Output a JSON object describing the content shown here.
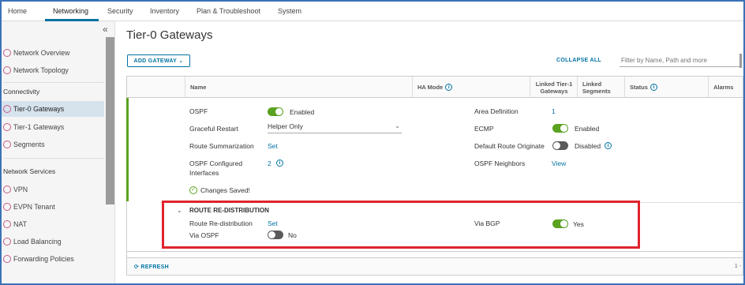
{
  "nav": {
    "tabs": [
      "Home",
      "Networking",
      "Security",
      "Inventory",
      "Plan & Troubleshoot",
      "System"
    ],
    "active": "Networking"
  },
  "sidebar": {
    "top_items": [
      {
        "label": "Network Overview",
        "icon": "network-overview-icon"
      },
      {
        "label": "Network Topology",
        "icon": "network-topology-icon"
      }
    ],
    "connectivity_header": "Connectivity",
    "connectivity_items": [
      {
        "label": "Tier-0 Gateways",
        "icon": "tier0-gateway-icon",
        "active": true
      },
      {
        "label": "Tier-1 Gateways",
        "icon": "tier1-gateway-icon"
      },
      {
        "label": "Segments",
        "icon": "segments-icon"
      }
    ],
    "services_header": "Network Services",
    "services_items": [
      {
        "label": "VPN",
        "icon": "vpn-icon"
      },
      {
        "label": "EVPN Tenant",
        "icon": "evpn-tenant-icon"
      },
      {
        "label": "NAT",
        "icon": "nat-icon"
      },
      {
        "label": "Load Balancing",
        "icon": "load-balancing-icon"
      },
      {
        "label": "Forwarding Policies",
        "icon": "forwarding-policies-icon"
      }
    ]
  },
  "page": {
    "title": "Tier-0 Gateways",
    "add_gateway": "ADD GATEWAY",
    "collapse_all": "COLLAPSE ALL",
    "filter_placeholder": "Filter by Name, Path and more"
  },
  "grid": {
    "columns": [
      "Name",
      "HA Mode",
      "Linked Tier-1 Gateways",
      "Linked Segments",
      "Status",
      "Alarms"
    ],
    "refresh": "REFRESH",
    "pager": "1 -"
  },
  "ospf": {
    "ospf_label": "OSPF",
    "ospf_value": "Enabled",
    "graceful_label": "Graceful Restart",
    "graceful_value": "Helper Only",
    "route_summ_label": "Route Summarization",
    "route_summ_value": "Set",
    "interfaces_label_1": "OSPF Configured",
    "interfaces_label_2": "Interfaces",
    "interfaces_value": "2",
    "area_label": "Area Definition",
    "area_value": "1",
    "ecmp_label": "ECMP",
    "ecmp_value": "Enabled",
    "default_route_label": "Default Route Originate",
    "default_route_value": "Disabled",
    "neighbors_label": "OSPF Neighbors",
    "neighbors_value": "View",
    "saved": "Changes Saved!"
  },
  "redistribution": {
    "title": "ROUTE RE-DISTRIBUTION",
    "route_label": "Route Re-distribution",
    "route_value": "Set",
    "via_ospf_label": "Via OSPF",
    "via_ospf_value": "No",
    "via_bgp_label": "Via BGP",
    "via_bgp_value": "Yes"
  },
  "colors": {
    "accent": "#0072a3",
    "toggle_on": "#5aa220",
    "highlight": "#e0242c"
  }
}
